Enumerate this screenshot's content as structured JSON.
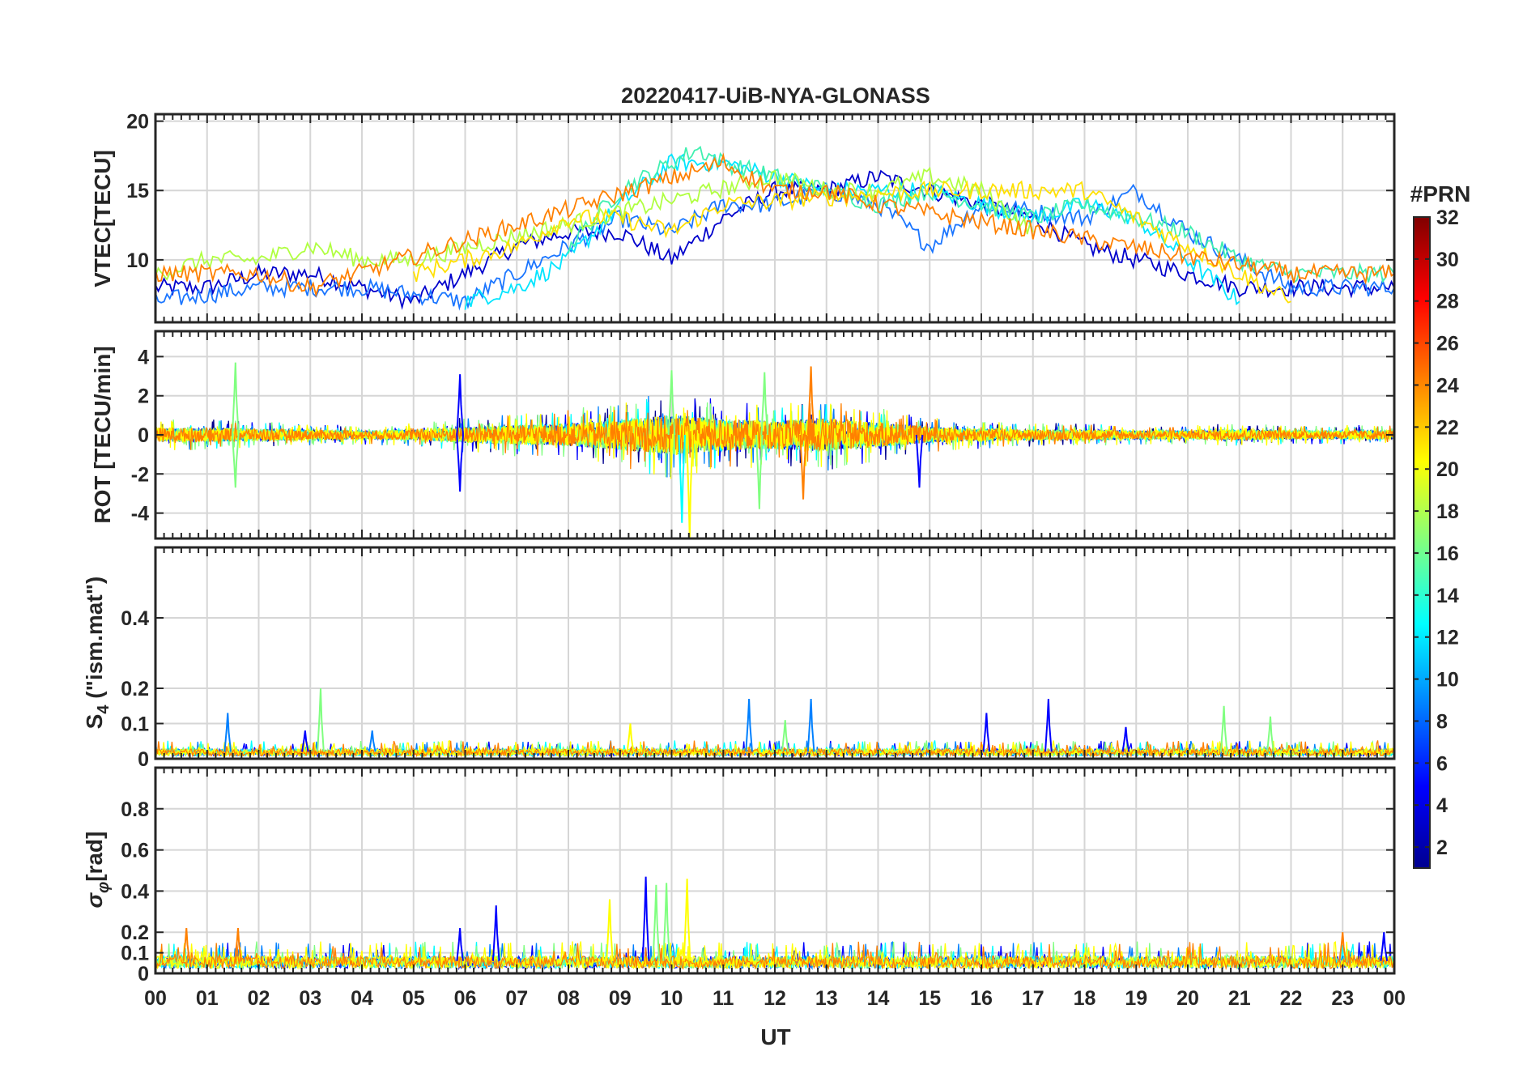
{
  "figure": {
    "title": "20220417-UiB-NYA-GLONASS",
    "xlabel": "UT",
    "x_tick_labels": [
      "00",
      "01",
      "02",
      "03",
      "04",
      "05",
      "06",
      "07",
      "08",
      "09",
      "10",
      "11",
      "12",
      "13",
      "14",
      "15",
      "16",
      "17",
      "18",
      "19",
      "20",
      "21",
      "22",
      "23",
      "00"
    ]
  },
  "colorbar": {
    "label": "#PRN",
    "range": [
      1,
      32
    ],
    "tick_labels": [
      "2",
      "4",
      "6",
      "8",
      "10",
      "12",
      "14",
      "16",
      "18",
      "20",
      "22",
      "24",
      "26",
      "28",
      "30",
      "32"
    ],
    "colormap": "jet",
    "colors": [
      "#00008f",
      "#0000ff",
      "#0080ff",
      "#00ffff",
      "#80ff80",
      "#ffff00",
      "#ff8000",
      "#ff0000",
      "#800000"
    ]
  },
  "chart_data": [
    {
      "type": "line",
      "panel": "vtec",
      "ylabel": "VTEC[TECU]",
      "y_tick_labels": [
        "10",
        "15",
        "20"
      ],
      "xlim": [
        0,
        24
      ],
      "ylim": [
        5.5,
        20.5
      ],
      "grid": true,
      "series": [
        {
          "prn": 3,
          "color": "#0000cc",
          "x": [
            0,
            1,
            2,
            3,
            4,
            5,
            6,
            7,
            8,
            9,
            10,
            11,
            12,
            13,
            14,
            15,
            16,
            17,
            18,
            19,
            20,
            21,
            22,
            23,
            24
          ],
          "y": [
            8,
            8,
            9,
            9,
            8,
            7,
            9,
            11,
            12,
            12,
            10,
            13,
            15,
            15,
            16,
            15,
            14,
            13,
            11,
            10,
            9,
            8,
            8,
            8,
            8
          ]
        },
        {
          "prn": 8,
          "color": "#1a75ff",
          "x": [
            0,
            2,
            4,
            6,
            8,
            9,
            10,
            11,
            12,
            13,
            14,
            15,
            16,
            18,
            19,
            20,
            22,
            24
          ],
          "y": [
            7,
            8,
            8,
            7,
            11,
            13,
            12,
            14,
            14,
            15,
            14,
            11,
            14,
            13,
            15,
            12,
            8,
            8
          ]
        },
        {
          "prn": 12,
          "color": "#00e5ff",
          "x": [
            6,
            7,
            8,
            9,
            10,
            11,
            12,
            13,
            14,
            15,
            16,
            17,
            18,
            19,
            20,
            21
          ],
          "y": [
            7,
            8,
            10,
            14,
            17,
            17,
            16,
            15,
            15,
            15,
            14,
            13,
            14,
            13,
            10,
            7
          ]
        },
        {
          "prn": 15,
          "color": "#40f0b0",
          "x": [
            8,
            9,
            10,
            10.5,
            11,
            12,
            13,
            14,
            15,
            16,
            17,
            18,
            20,
            21,
            22,
            23,
            24
          ],
          "y": [
            11,
            15,
            17,
            18,
            17,
            16,
            15,
            14,
            15,
            14,
            13,
            14,
            12,
            10,
            9,
            9,
            9
          ]
        },
        {
          "prn": 18,
          "color": "#b0ff40",
          "x": [
            0,
            1,
            2,
            3,
            4,
            5,
            12,
            13,
            14,
            15,
            16,
            17
          ],
          "y": [
            9,
            10,
            10,
            11,
            10,
            10,
            16,
            15,
            15,
            16,
            15,
            12
          ]
        },
        {
          "prn": 20,
          "color": "#ffe000",
          "x": [
            5,
            6,
            7,
            8,
            9,
            10,
            11,
            15,
            16,
            17,
            18,
            19,
            20,
            21,
            22
          ],
          "y": [
            9,
            10,
            11,
            13,
            13,
            12,
            14,
            15,
            15,
            15,
            15,
            13,
            11,
            9,
            7
          ]
        },
        {
          "prn": 23,
          "color": "#ff8000",
          "x": [
            0,
            1,
            2,
            3,
            11,
            12,
            13,
            14,
            22,
            23,
            24
          ],
          "y": [
            9,
            9,
            9,
            8,
            17,
            15,
            15,
            14,
            9,
            9,
            9
          ]
        }
      ]
    },
    {
      "type": "line",
      "panel": "rot",
      "ylabel": "ROT [TECU/min]",
      "y_tick_labels": [
        "-4",
        "-2",
        "0",
        "2",
        "4"
      ],
      "xlim": [
        0,
        24
      ],
      "ylim": [
        -5.3,
        5.3
      ],
      "grid": true,
      "noise_envelope": {
        "x": [
          0,
          1,
          2,
          3,
          4,
          5,
          6,
          7,
          8,
          9,
          10,
          11,
          12,
          13,
          14,
          15,
          16,
          17,
          18,
          19,
          20,
          21,
          22,
          23,
          24
        ],
        "amplitude": [
          0.8,
          0.8,
          0.7,
          0.6,
          0.5,
          0.6,
          0.9,
          1.1,
          1.3,
          1.7,
          2.3,
          1.8,
          1.6,
          1.9,
          1.4,
          0.9,
          0.7,
          0.6,
          0.6,
          0.5,
          0.5,
          0.6,
          0.5,
          0.5,
          0.5
        ]
      },
      "spikes": [
        {
          "x": 1.55,
          "y": 3.7,
          "prn": 17
        },
        {
          "x": 1.55,
          "y": -2.7,
          "prn": 17
        },
        {
          "x": 5.9,
          "y": 3.1,
          "prn": 3
        },
        {
          "x": 5.9,
          "y": -2.9,
          "prn": 3
        },
        {
          "x": 10.0,
          "y": 3.3,
          "prn": 15
        },
        {
          "x": 10.2,
          "y": -4.5,
          "prn": 13
        },
        {
          "x": 10.35,
          "y": -5.3,
          "prn": 22
        },
        {
          "x": 11.7,
          "y": -3.8,
          "prn": 15
        },
        {
          "x": 11.8,
          "y": 3.2,
          "prn": 15
        },
        {
          "x": 12.7,
          "y": 3.5,
          "prn": 23
        },
        {
          "x": 12.55,
          "y": -3.3,
          "prn": 23
        },
        {
          "x": 14.8,
          "y": -2.7,
          "prn": 3
        }
      ]
    },
    {
      "type": "line",
      "panel": "s4",
      "ylabel": "S_4 (\"ism.mat\")",
      "y_tick_labels": [
        "0",
        "0.1",
        "0.2",
        "0.4"
      ],
      "xlim": [
        0,
        24
      ],
      "ylim": [
        0,
        0.6
      ],
      "grid": true,
      "baseline": 0.02,
      "spikes": [
        {
          "x": 1.4,
          "y": 0.13,
          "prn": 9
        },
        {
          "x": 3.2,
          "y": 0.2,
          "prn": 17
        },
        {
          "x": 2.9,
          "y": 0.08,
          "prn": 6
        },
        {
          "x": 4.2,
          "y": 0.08,
          "prn": 9
        },
        {
          "x": 9.2,
          "y": 0.1,
          "prn": 22
        },
        {
          "x": 11.5,
          "y": 0.17,
          "prn": 8
        },
        {
          "x": 12.7,
          "y": 0.17,
          "prn": 8
        },
        {
          "x": 12.2,
          "y": 0.11,
          "prn": 16
        },
        {
          "x": 16.1,
          "y": 0.13,
          "prn": 4
        },
        {
          "x": 17.3,
          "y": 0.17,
          "prn": 3
        },
        {
          "x": 20.7,
          "y": 0.15,
          "prn": 15
        },
        {
          "x": 21.6,
          "y": 0.12,
          "prn": 15
        },
        {
          "x": 18.8,
          "y": 0.09,
          "prn": 3
        }
      ]
    },
    {
      "type": "line",
      "panel": "sigma_phi",
      "ylabel": "σ_φ[rad]",
      "y_tick_labels": [
        "0",
        "0.1",
        "0.2",
        "0.4",
        "0.6",
        "0.8"
      ],
      "xlim": [
        0,
        24
      ],
      "ylim": [
        0,
        1.0
      ],
      "grid": true,
      "baseline": 0.06,
      "spikes": [
        {
          "x": 9.5,
          "y": 0.47,
          "prn": 4
        },
        {
          "x": 10.3,
          "y": 0.46,
          "prn": 21
        },
        {
          "x": 9.9,
          "y": 0.44,
          "prn": 15
        },
        {
          "x": 9.7,
          "y": 0.43,
          "prn": 16
        },
        {
          "x": 8.8,
          "y": 0.36,
          "prn": 20
        },
        {
          "x": 6.6,
          "y": 0.33,
          "prn": 3
        },
        {
          "x": 5.9,
          "y": 0.22,
          "prn": 4
        },
        {
          "x": 1.6,
          "y": 0.22,
          "prn": 23
        },
        {
          "x": 0.6,
          "y": 0.22,
          "prn": 24
        },
        {
          "x": 23.0,
          "y": 0.2,
          "prn": 24
        },
        {
          "x": 23.8,
          "y": 0.2,
          "prn": 6
        }
      ]
    }
  ]
}
